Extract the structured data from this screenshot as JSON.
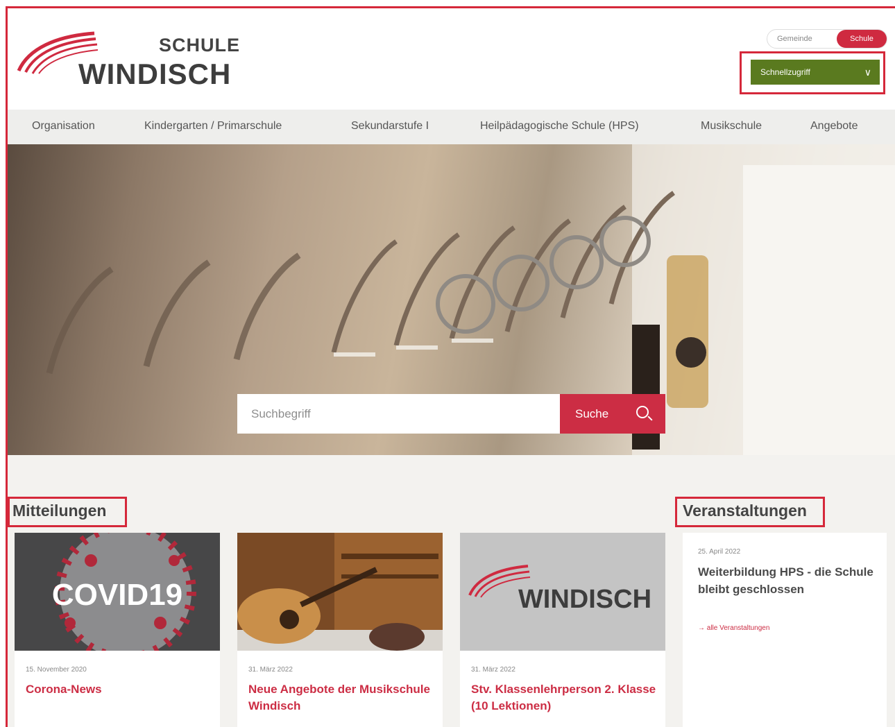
{
  "brand": {
    "line1": "SCHULE",
    "line2": "WINDISCH",
    "accent": "#cf2a40",
    "green": "#5a7a1f"
  },
  "toggle": {
    "gemeinde": "Gemeinde",
    "schule": "Schule"
  },
  "quick_access": {
    "label": "Schnellzugriff",
    "chevron": "∨"
  },
  "nav": {
    "items": [
      "Organisation",
      "Kindergarten / Primarschule",
      "Sekundarstufe I",
      "Heilpädagogische Schule (HPS)",
      "Musikschule",
      "Angebote"
    ]
  },
  "search": {
    "placeholder": "Suchbegriff",
    "button": "Suche"
  },
  "news": {
    "heading": "Mitteilungen",
    "cards": [
      {
        "date": "15. November 2020",
        "title": "Corona-News",
        "image_text": "COVID19"
      },
      {
        "date": "31. März 2022",
        "title": "Neue Angebote der Musikschule Windisch"
      },
      {
        "date": "31. März 2022",
        "title": "Stv. Klassenlehrperson 2. Klasse (10 Lektionen)",
        "image_text": "WINDISCH"
      }
    ]
  },
  "events": {
    "heading": "Veranstaltungen",
    "items": [
      {
        "date": "25. April 2022",
        "title": "Weiterbildung HPS - die Schule bleibt geschlossen"
      }
    ],
    "all_link": "→ alle Veranstaltungen"
  }
}
